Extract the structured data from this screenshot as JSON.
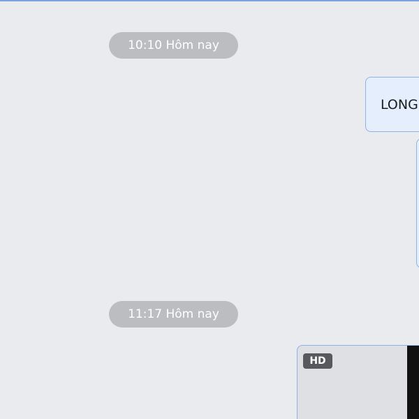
{
  "messages": {
    "timestamp_1": "10:10 Hôm nay",
    "text_message": "LONG",
    "timestamp_2": "11:17 Hôm nay",
    "media_badge": "HD"
  },
  "colors": {
    "background": "#eaebee",
    "timestamp_chip": "#bcbdc0",
    "bubble_fill": "#e4eefc",
    "bubble_border": "#8fb1e6",
    "badge": "#58595c"
  }
}
